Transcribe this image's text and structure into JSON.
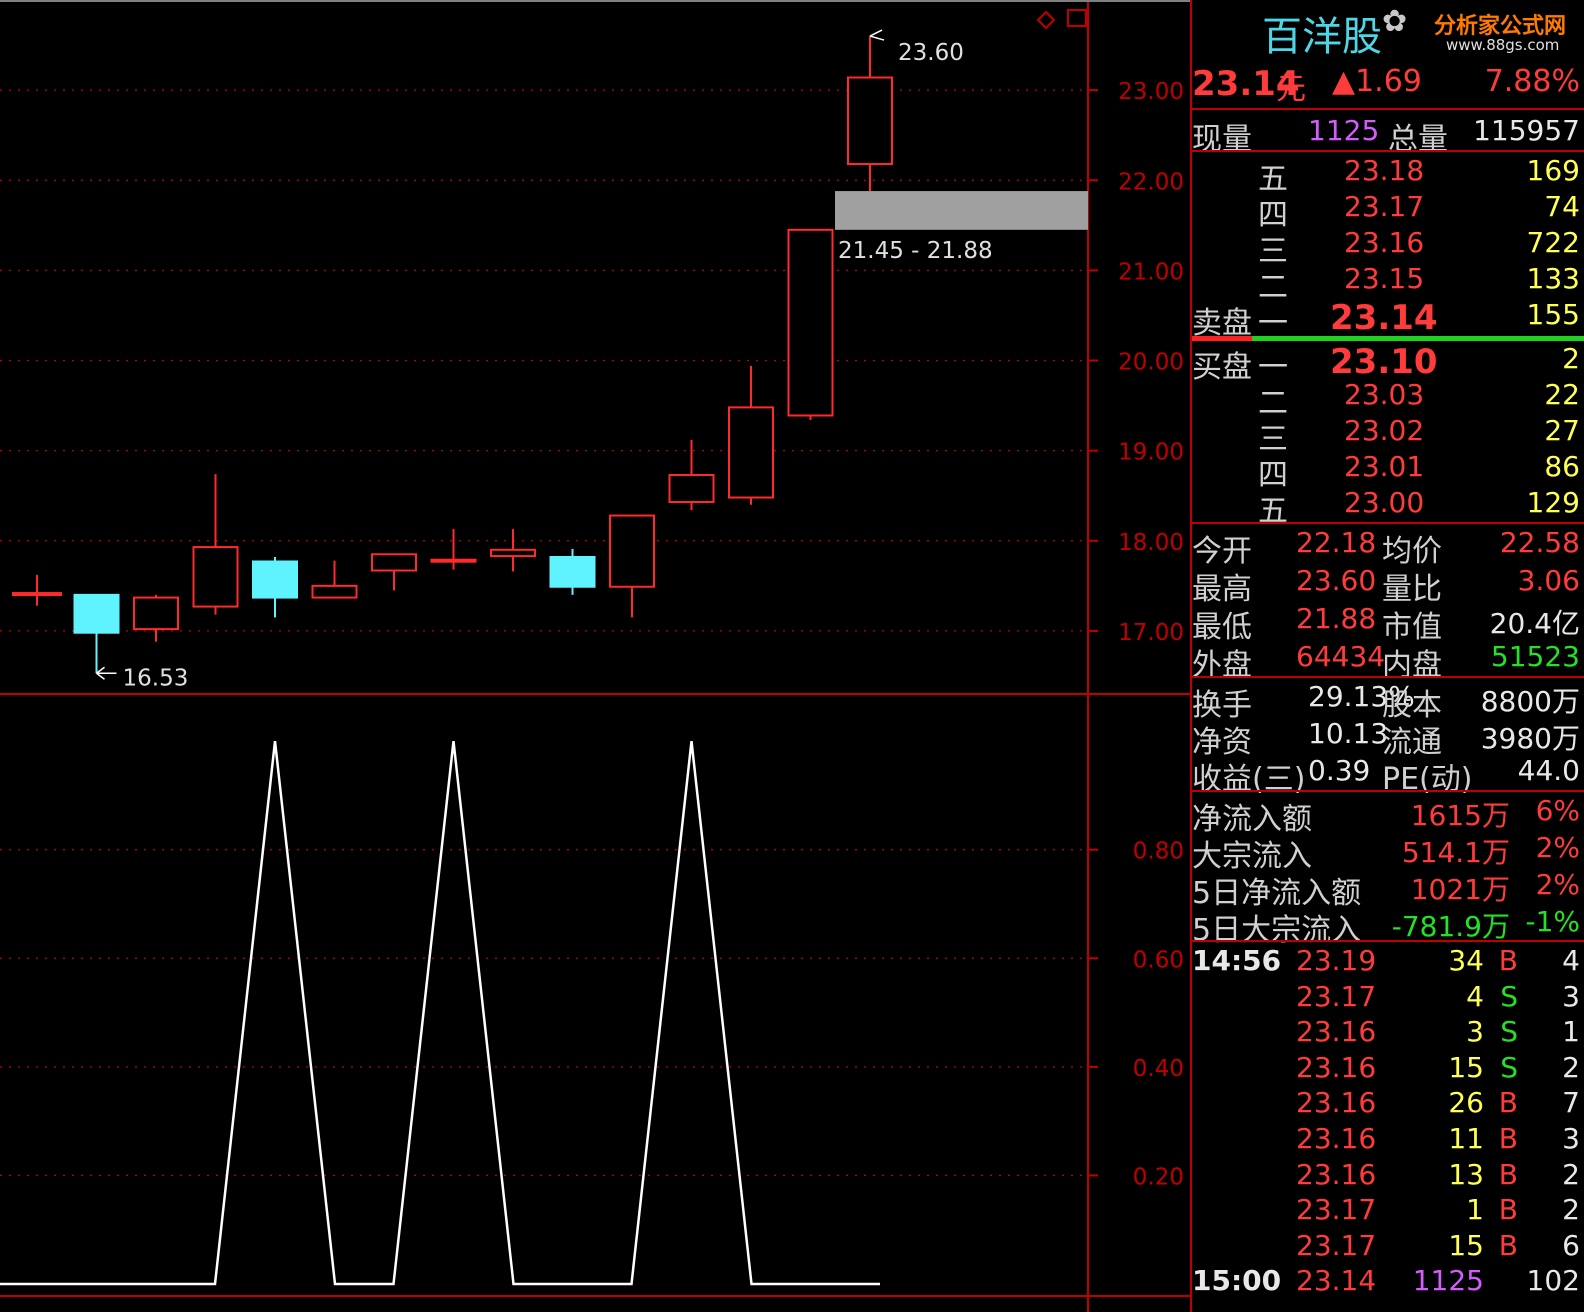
{
  "header": {
    "stock_name": "百洋股",
    "watermark": "分析家公式网",
    "watermark_url": "www.88gs.com",
    "price": "23.14",
    "price_unit": "元",
    "change": "▲1.69",
    "change_pct": "7.88%"
  },
  "volume_row": {
    "now_label": "现量",
    "now_value": "1125",
    "total_label": "总量",
    "total_value": "115957"
  },
  "sell_book": [
    {
      "level": "五",
      "price": "23.18",
      "qty": "169"
    },
    {
      "level": "四",
      "price": "23.17",
      "qty": "74"
    },
    {
      "level": "三",
      "price": "23.16",
      "qty": "722"
    },
    {
      "level": "二",
      "price": "23.15",
      "qty": "133"
    },
    {
      "side": "卖盘",
      "level": "一",
      "price": "23.14",
      "qty": "155"
    }
  ],
  "buy_book": [
    {
      "side": "买盘",
      "level": "一",
      "price": "23.10",
      "qty": "2"
    },
    {
      "level": "二",
      "price": "23.03",
      "qty": "22"
    },
    {
      "level": "三",
      "price": "23.02",
      "qty": "27"
    },
    {
      "level": "四",
      "price": "23.01",
      "qty": "86"
    },
    {
      "level": "五",
      "price": "23.00",
      "qty": "129"
    }
  ],
  "quote_stats": [
    {
      "l1": "今开",
      "v1": "22.18",
      "l2": "均价",
      "v2": "22.58"
    },
    {
      "l1": "最高",
      "v1": "23.60",
      "l2": "量比",
      "v2": "3.06"
    },
    {
      "l1": "最低",
      "v1": "21.88",
      "l2": "市值",
      "v2": "20.4亿"
    },
    {
      "l1": "外盘",
      "v1": "64434",
      "l2": "内盘",
      "v2": "51523"
    }
  ],
  "fundamentals": [
    {
      "l1": "换手",
      "v1": "29.13%",
      "l2": "股本",
      "v2": "8800万"
    },
    {
      "l1": "净资",
      "v1": "10.13",
      "l2": "流通",
      "v2": "3980万"
    },
    {
      "l1": "收益(三)",
      "v1": "0.39",
      "l2": "PE(动)",
      "v2": "44.0"
    }
  ],
  "flows": [
    {
      "label": "净流入额",
      "value": "1615万",
      "pct": "6%"
    },
    {
      "label": "大宗流入",
      "value": "514.1万",
      "pct": "2%"
    },
    {
      "label": "5日净流入额",
      "value": "1021万",
      "pct": "2%"
    },
    {
      "label": "5日大宗流入",
      "value": "-781.9万",
      "pct": "-1%"
    }
  ],
  "ticks": [
    {
      "time": "14:56",
      "price": "23.19",
      "qty": "34",
      "side": "B",
      "n": "4"
    },
    {
      "time": "",
      "price": "23.17",
      "qty": "4",
      "side": "S",
      "n": "3"
    },
    {
      "time": "",
      "price": "23.16",
      "qty": "3",
      "side": "S",
      "n": "1"
    },
    {
      "time": "",
      "price": "23.16",
      "qty": "15",
      "side": "S",
      "n": "2"
    },
    {
      "time": "",
      "price": "23.16",
      "qty": "26",
      "side": "B",
      "n": "7"
    },
    {
      "time": "",
      "price": "23.16",
      "qty": "11",
      "side": "B",
      "n": "3"
    },
    {
      "time": "",
      "price": "23.16",
      "qty": "13",
      "side": "B",
      "n": "2"
    },
    {
      "time": "",
      "price": "23.17",
      "qty": "1",
      "side": "B",
      "n": "2"
    },
    {
      "time": "",
      "price": "23.17",
      "qty": "15",
      "side": "B",
      "n": "6"
    },
    {
      "time": "15:00",
      "price": "23.14",
      "qty": "1125",
      "side": "",
      "n": "102"
    }
  ],
  "colors": {
    "grid": "#c00000",
    "up": "#ff2a2a",
    "down": "#5ff2ff",
    "gap": "#a0a0a0",
    "line": "#ffffff"
  },
  "chart_data": [
    {
      "type": "candlestick",
      "ylim": [
        16.3,
        24.0
      ],
      "yticks": [
        "17.00",
        "18.00",
        "19.00",
        "20.00",
        "21.00",
        "22.00",
        "23.00"
      ],
      "candles": [
        {
          "open": 17.42,
          "close": 17.42,
          "high": 17.62,
          "low": 17.28
        },
        {
          "open": 17.4,
          "close": 16.98,
          "high": 17.4,
          "low": 16.53
        },
        {
          "open": 17.02,
          "close": 17.37,
          "high": 17.4,
          "low": 16.88
        },
        {
          "open": 17.27,
          "close": 17.93,
          "high": 18.74,
          "low": 17.18
        },
        {
          "open": 17.77,
          "close": 17.37,
          "high": 17.82,
          "low": 17.15
        },
        {
          "open": 17.37,
          "close": 17.5,
          "high": 17.78,
          "low": 17.37
        },
        {
          "open": 17.67,
          "close": 17.85,
          "high": 17.85,
          "low": 17.45
        },
        {
          "open": 17.79,
          "close": 17.79,
          "high": 18.13,
          "low": 17.68
        },
        {
          "open": 17.83,
          "close": 17.9,
          "high": 18.13,
          "low": 17.66
        },
        {
          "open": 17.82,
          "close": 17.49,
          "high": 17.91,
          "low": 17.4
        },
        {
          "open": 17.49,
          "close": 18.28,
          "high": 18.29,
          "low": 17.15
        },
        {
          "open": 18.43,
          "close": 18.73,
          "high": 19.12,
          "low": 18.34
        },
        {
          "open": 18.48,
          "close": 19.48,
          "high": 19.94,
          "low": 18.4
        },
        {
          "open": 19.39,
          "close": 21.45,
          "high": 21.45,
          "low": 19.34
        },
        {
          "open": 22.18,
          "close": 23.14,
          "high": 23.6,
          "low": 21.88
        }
      ],
      "annotations": {
        "high_label": "23.60",
        "low_label": "16.53",
        "gap_label": "21.45 - 21.88",
        "gap_low": 21.45,
        "gap_high": 21.88
      }
    },
    {
      "type": "line",
      "ylim": [
        0,
        1.05
      ],
      "yticks": [
        "0.20",
        "0.40",
        "0.60",
        "0.80"
      ],
      "values": [
        0,
        0,
        0,
        0,
        1,
        0,
        0,
        1,
        0,
        0,
        0,
        1,
        0,
        0,
        0
      ]
    }
  ]
}
